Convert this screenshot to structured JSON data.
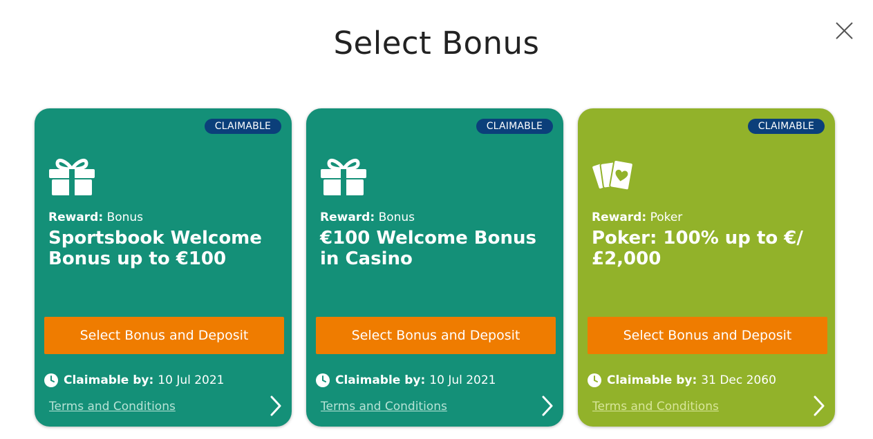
{
  "modal": {
    "title": "Select Bonus",
    "close_icon": "close-icon"
  },
  "colors": {
    "teal": "#149078",
    "green": "#92b22a",
    "badge": "#0b3f7a",
    "button": "#ef7c00",
    "terms_link_green": "#d8e69a",
    "terms_link_teal": "#b7e3d6"
  },
  "cards": [
    {
      "badge": "CLAIMABLE",
      "icon": "gift-icon",
      "reward_label": "Reward:",
      "reward_value": "Bonus",
      "title": "Sportsbook Welcome Bonus up to €100",
      "button_label": "Select Bonus and Deposit",
      "claim_label": "Claimable by:",
      "claim_date": "10 Jul 2021",
      "terms_label": "Terms and Conditions"
    },
    {
      "badge": "CLAIMABLE",
      "icon": "gift-icon",
      "reward_label": "Reward:",
      "reward_value": "Bonus",
      "title": "€100 Welcome Bonus in Casino",
      "button_label": "Select Bonus and Deposit",
      "claim_label": "Claimable by:",
      "claim_date": "10 Jul 2021",
      "terms_label": "Terms and Conditions"
    },
    {
      "badge": "CLAIMABLE",
      "icon": "playing-cards-icon",
      "reward_label": "Reward:",
      "reward_value": "Poker",
      "title": "Poker: 100% up to €/£2,000",
      "button_label": "Select Bonus and Deposit",
      "claim_label": "Claimable by:",
      "claim_date": "31 Dec 2060",
      "terms_label": "Terms and Conditions"
    }
  ]
}
